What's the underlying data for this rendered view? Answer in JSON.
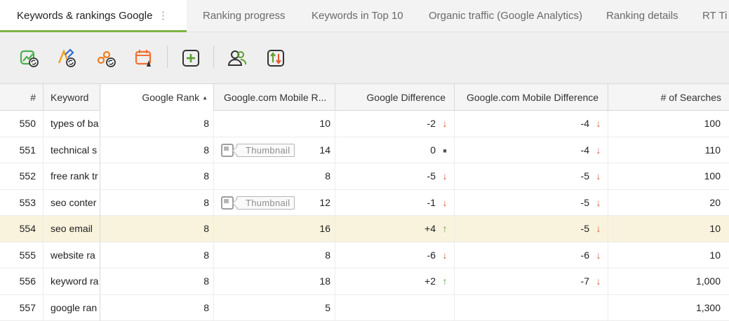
{
  "tabs": [
    {
      "label": "Keywords & rankings Google",
      "active": true
    },
    {
      "label": "Ranking progress",
      "active": false
    },
    {
      "label": "Keywords in Top 10",
      "active": false
    },
    {
      "label": "Organic traffic (Google Analytics)",
      "active": false
    },
    {
      "label": "Ranking details",
      "active": false
    },
    {
      "label": "RT Ti",
      "active": false
    }
  ],
  "tab_menu_glyph": "⋮",
  "toolbar": {
    "buttons": [
      {
        "icon": "check-rankings-icon",
        "color": "#4caf50"
      },
      {
        "icon": "edit-keywords-icon",
        "color": "#f0a020"
      },
      {
        "icon": "serp-history-icon",
        "color": "#f08020"
      },
      {
        "icon": "schedule-icon",
        "color": "#f07030"
      },
      {
        "icon": "add-keyword-icon",
        "color": "#5aa02c"
      },
      {
        "icon": "competitors-icon",
        "color": "#333333"
      },
      {
        "icon": "sort-import-icon",
        "color": "#333333"
      }
    ]
  },
  "table": {
    "columns": [
      "#",
      "Keyword",
      "Google Rank",
      "Google.com Mobile R...",
      "Google Difference",
      "Google.com Mobile Difference",
      "# of Searches"
    ],
    "sort_glyph": "▲",
    "thumbnail_label": "Thumbnail",
    "rows": [
      {
        "num": "550",
        "keyword": "types of ba",
        "google_rank": "8",
        "mobile_rank": "10",
        "google_diff": "-2",
        "google_dir": "down",
        "mobile_diff": "-4",
        "mobile_dir": "down",
        "searches": "100",
        "thumbnail": false,
        "highlight": false
      },
      {
        "num": "551",
        "keyword": "technical s",
        "google_rank": "8",
        "mobile_rank": "14",
        "google_diff": "0",
        "google_dir": "flat",
        "mobile_diff": "-4",
        "mobile_dir": "down",
        "searches": "110",
        "thumbnail": true,
        "highlight": false
      },
      {
        "num": "552",
        "keyword": "free rank tr",
        "google_rank": "8",
        "mobile_rank": "8",
        "google_diff": "-5",
        "google_dir": "down",
        "mobile_diff": "-5",
        "mobile_dir": "down",
        "searches": "100",
        "thumbnail": false,
        "highlight": false
      },
      {
        "num": "553",
        "keyword": "seo conter",
        "google_rank": "8",
        "mobile_rank": "12",
        "google_diff": "-1",
        "google_dir": "down",
        "mobile_diff": "-5",
        "mobile_dir": "down",
        "searches": "20",
        "thumbnail": true,
        "highlight": false
      },
      {
        "num": "554",
        "keyword": "seo email",
        "google_rank": "8",
        "mobile_rank": "16",
        "google_diff": "+4",
        "google_dir": "up",
        "mobile_diff": "-5",
        "mobile_dir": "down",
        "searches": "10",
        "thumbnail": false,
        "highlight": true
      },
      {
        "num": "555",
        "keyword": "website ra",
        "google_rank": "8",
        "mobile_rank": "8",
        "google_diff": "-6",
        "google_dir": "down",
        "mobile_diff": "-6",
        "mobile_dir": "down",
        "searches": "10",
        "thumbnail": false,
        "highlight": false
      },
      {
        "num": "556",
        "keyword": "keyword ra",
        "google_rank": "8",
        "mobile_rank": "18",
        "google_diff": "+2",
        "google_dir": "up",
        "mobile_diff": "-7",
        "mobile_dir": "down",
        "searches": "1,000",
        "thumbnail": false,
        "highlight": false
      },
      {
        "num": "557",
        "keyword": "google ran",
        "google_rank": "8",
        "mobile_rank": "5",
        "google_diff": "",
        "google_dir": "",
        "mobile_diff": "",
        "mobile_dir": "",
        "searches": "1,300",
        "thumbnail": false,
        "highlight": false
      }
    ]
  },
  "colors": {
    "accent": "#7cb342",
    "down": "#e0562f",
    "up": "#5aa02c",
    "highlight_row": "#f9f3dd"
  }
}
